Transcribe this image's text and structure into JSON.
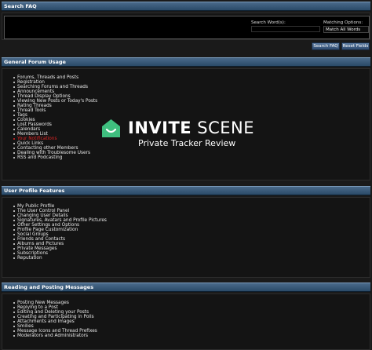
{
  "search": {
    "title": "Search FAQ",
    "words_label": "Search Word(s):",
    "match_label": "Matching Options:",
    "match_value": "Match All Words",
    "search_button": "Search FAQ",
    "reset_button": "Reset Fields"
  },
  "sections": [
    {
      "title": "General Forum Usage",
      "items": [
        "Forums, Threads and Posts",
        "Registration",
        "Searching Forums and Threads",
        "Announcements",
        "Thread Display Options",
        "Viewing New Posts or Today's Posts",
        "Rating Threads",
        "Thread Tools",
        "Tags",
        "Cookies",
        "Lost Passwords",
        "Calendars",
        "Members List",
        "Your Notifications",
        "Quick Links",
        "Contacting other Members",
        "Dealing with Troublesome Users",
        "RSS and Podcasting"
      ],
      "highlight_index": 13
    },
    {
      "title": "User Profile Features",
      "items": [
        "My Public Profile",
        "The User Control Panel",
        "Changing User Details",
        "Signatures, Avatars and Profile Pictures",
        "Other Settings and Options",
        "Profile Page Customization",
        "Social Groups",
        "Friends and Contacts",
        "Albums and Pictures",
        "Private Messages",
        "Subscriptions",
        "Reputation"
      ]
    },
    {
      "title": "Reading and Posting Messages",
      "items": [
        "Posting New Messages",
        "Replying to a Post",
        "Editing and Deleting your Posts",
        "Creating and Participating in Polls",
        "Attachments and Images",
        "Smilies",
        "Message Icons and Thread Prefixes",
        "Moderators and Administrators"
      ]
    }
  ],
  "watermark": {
    "brand_bold": "INVITE",
    "brand_light": " SCENE",
    "tagline": "Private Tracker Review",
    "icon": "envelope-logo-icon",
    "accent": "#3fbf7f"
  }
}
